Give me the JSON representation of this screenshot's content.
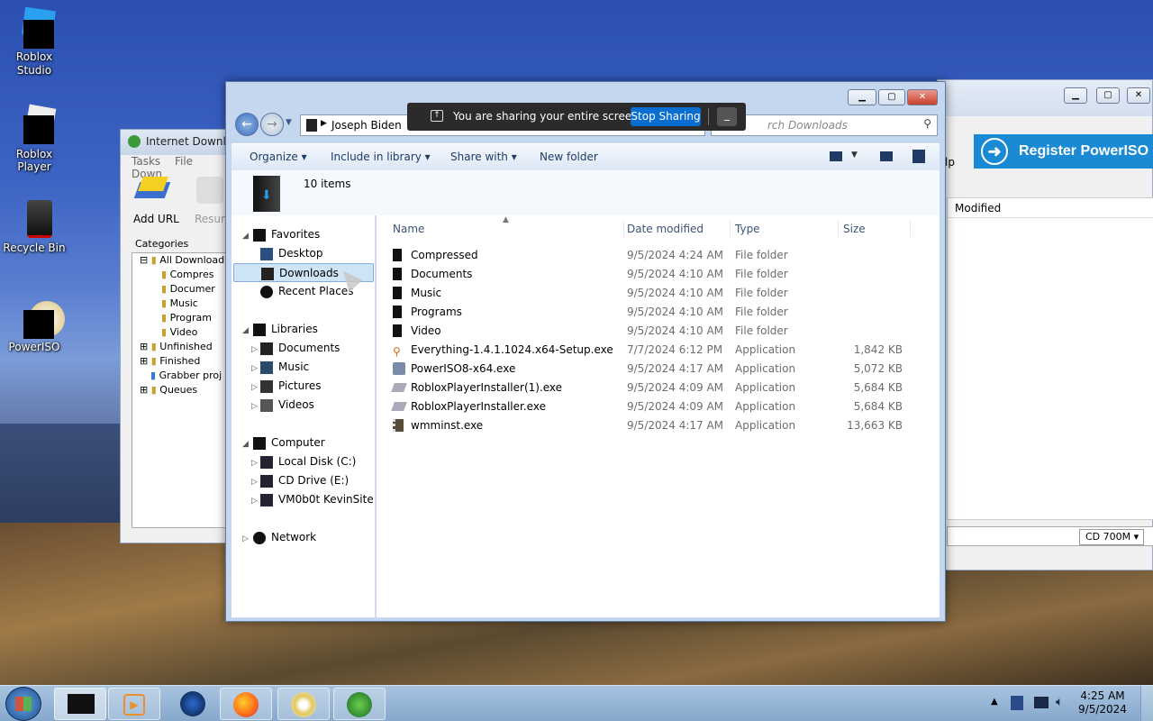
{
  "desktop": {
    "icons": [
      {
        "label": "Roblox\nStudio"
      },
      {
        "label": "Roblox Player"
      },
      {
        "label": "Recycle Bin"
      },
      {
        "label": "PowerISO"
      }
    ]
  },
  "idm": {
    "title": "Internet Downlo",
    "menu": [
      "Tasks",
      "File",
      "Down"
    ],
    "toolbar": {
      "add_url": "Add URL",
      "resume": "Resum"
    },
    "categories_header": "Categories",
    "categories": [
      "All Download",
      "Compres",
      "Documer",
      "Music",
      "Program",
      "Video",
      "Unfinished",
      "Finished",
      "Grabber proj",
      "Queues"
    ]
  },
  "poweriso": {
    "register": "Register PowerISO",
    "help_fragment": "lp",
    "column_modified": "Modified",
    "media": "CD 700M"
  },
  "explorer": {
    "breadcrumb": "Joseph Biden",
    "search_placeholder": "rch Downloads",
    "commands": {
      "organize": "Organize",
      "include": "Include in library",
      "share": "Share with",
      "new_folder": "New folder"
    },
    "item_count": "10 items",
    "nav": {
      "favorites": "Favorites",
      "desktop": "Desktop",
      "downloads": "Downloads",
      "recent": "Recent Places",
      "libraries": "Libraries",
      "documents": "Documents",
      "music": "Music",
      "pictures": "Pictures",
      "videos": "Videos",
      "computer": "Computer",
      "local_disk": "Local Disk (C:)",
      "cd_drive": "CD Drive (E:)",
      "vm": "VM0b0t KevinSite",
      "network": "Network"
    },
    "columns": {
      "name": "Name",
      "date": "Date modified",
      "type": "Type",
      "size": "Size"
    },
    "files": [
      {
        "name": "Compressed",
        "date": "9/5/2024 4:24 AM",
        "type": "File folder",
        "size": ""
      },
      {
        "name": "Documents",
        "date": "9/5/2024 4:10 AM",
        "type": "File folder",
        "size": ""
      },
      {
        "name": "Music",
        "date": "9/5/2024 4:10 AM",
        "type": "File folder",
        "size": ""
      },
      {
        "name": "Programs",
        "date": "9/5/2024 4:10 AM",
        "type": "File folder",
        "size": ""
      },
      {
        "name": "Video",
        "date": "9/5/2024 4:10 AM",
        "type": "File folder",
        "size": ""
      },
      {
        "name": "Everything-1.4.1.1024.x64-Setup.exe",
        "date": "7/7/2024 6:12 PM",
        "type": "Application",
        "size": "1,842 KB"
      },
      {
        "name": "PowerISO8-x64.exe",
        "date": "9/5/2024 4:17 AM",
        "type": "Application",
        "size": "5,072 KB"
      },
      {
        "name": "RobloxPlayerInstaller(1).exe",
        "date": "9/5/2024 4:09 AM",
        "type": "Application",
        "size": "5,684 KB"
      },
      {
        "name": "RobloxPlayerInstaller.exe",
        "date": "9/5/2024 4:09 AM",
        "type": "Application",
        "size": "5,684 KB"
      },
      {
        "name": "wmminst.exe",
        "date": "9/5/2024 4:17 AM",
        "type": "Application",
        "size": "13,663 KB"
      }
    ]
  },
  "share_bar": {
    "message": "You are sharing your entire screen.",
    "stop": "Stop Sharing",
    "minimize": "_"
  },
  "taskbar": {
    "time": "4:25 AM",
    "date": "9/5/2024"
  }
}
